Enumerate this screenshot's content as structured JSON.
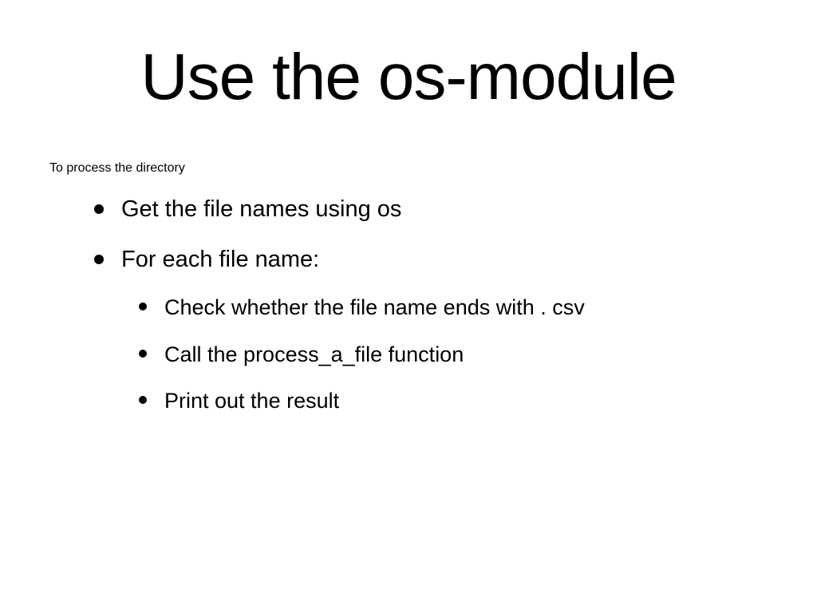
{
  "title": "Use the os-module",
  "bullets": {
    "l1_0": "To process the directory",
    "l2_0": "Get the file names using os",
    "l2_1": "For each file name:",
    "l3_0": "Check whether the file name ends with . csv",
    "l3_1": "Call the process_a_file function",
    "l3_2": "Print out the result"
  }
}
